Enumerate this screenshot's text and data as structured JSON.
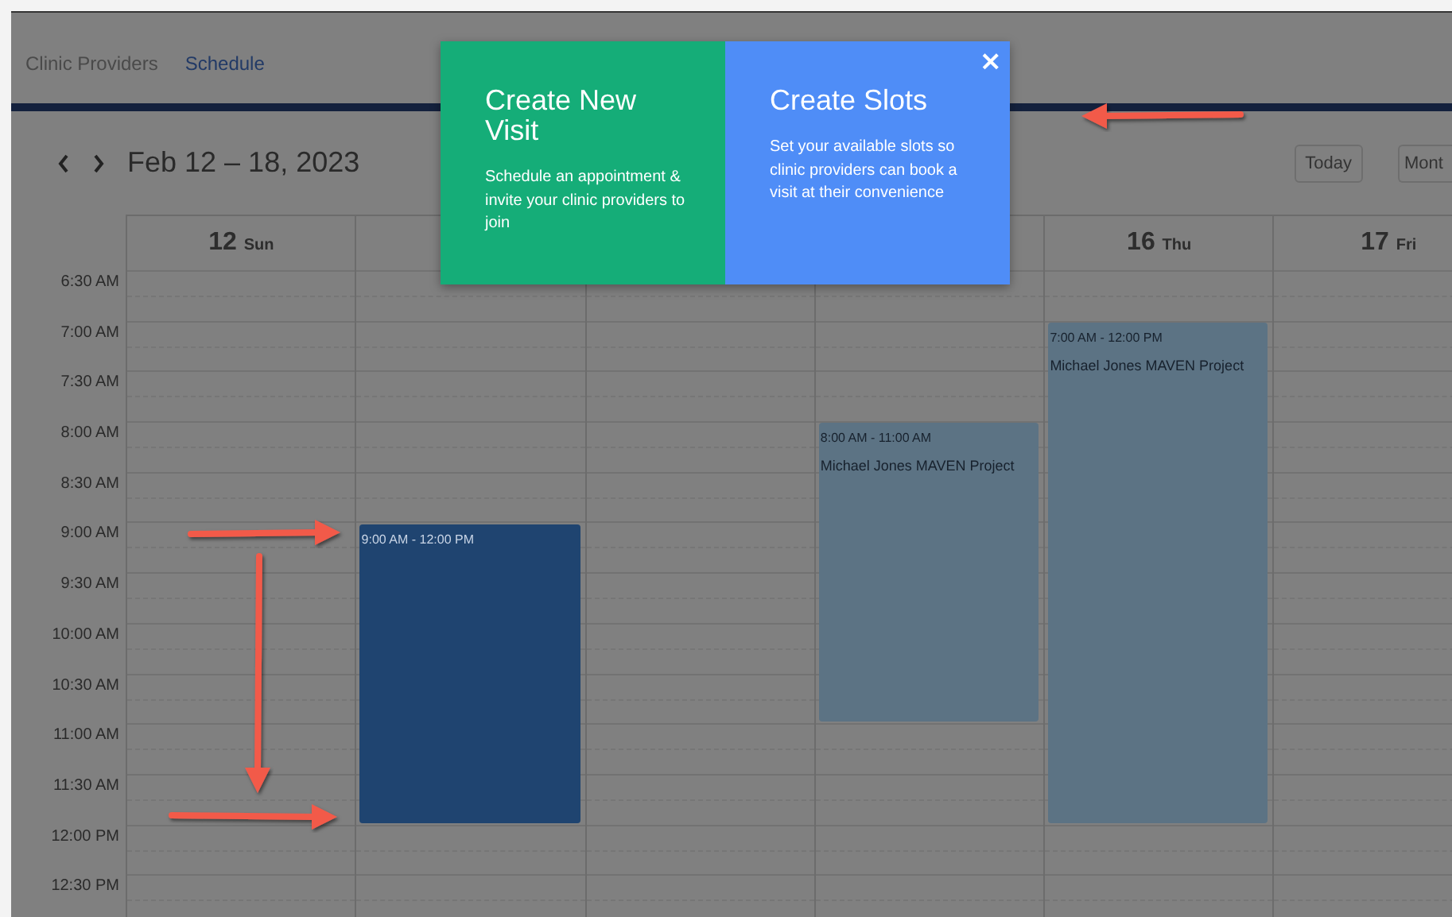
{
  "nav": {
    "tabs": [
      {
        "label": "Clinic Providers",
        "selected": false
      },
      {
        "label": "Schedule",
        "selected": true
      }
    ]
  },
  "toolbar": {
    "range": "Feb 12 – 18, 2023",
    "buttons": [
      "Today",
      "Mont"
    ]
  },
  "calendar": {
    "day_headers": [
      {
        "date": "12",
        "weekday": "Sun"
      },
      {
        "date": "16",
        "weekday": "Thu"
      },
      {
        "date": "17",
        "weekday": "Fri"
      }
    ],
    "times": [
      "6:30 AM",
      "7:00 AM",
      "7:30 AM",
      "8:00 AM",
      "8:30 AM",
      "9:00 AM",
      "9:30 AM",
      "10:00 AM",
      "10:30 AM",
      "11:00 AM",
      "11:30 AM",
      "12:00 PM",
      "12:30 PM"
    ],
    "events": [
      {
        "time": "9:00 AM - 12:00 PM",
        "color": "#1f4470"
      },
      {
        "time": "8:00 AM - 11:00 AM",
        "title": "Michael Jones MAVEN Project",
        "color": "#5c7384"
      },
      {
        "time": "7:00 AM - 12:00 PM",
        "title": "Michael Jones MAVEN Project",
        "color": "#5c7384"
      }
    ]
  },
  "modal": {
    "close": "×",
    "cards": [
      {
        "title": "Create New Visit",
        "text": "Schedule an appointment & invite your clinic providers to join",
        "color": "#15ad78"
      },
      {
        "title": "Create Slots",
        "text": "Set your available slots so clinic providers can book a visit at their convenience",
        "color": "#4f8df7"
      }
    ]
  }
}
